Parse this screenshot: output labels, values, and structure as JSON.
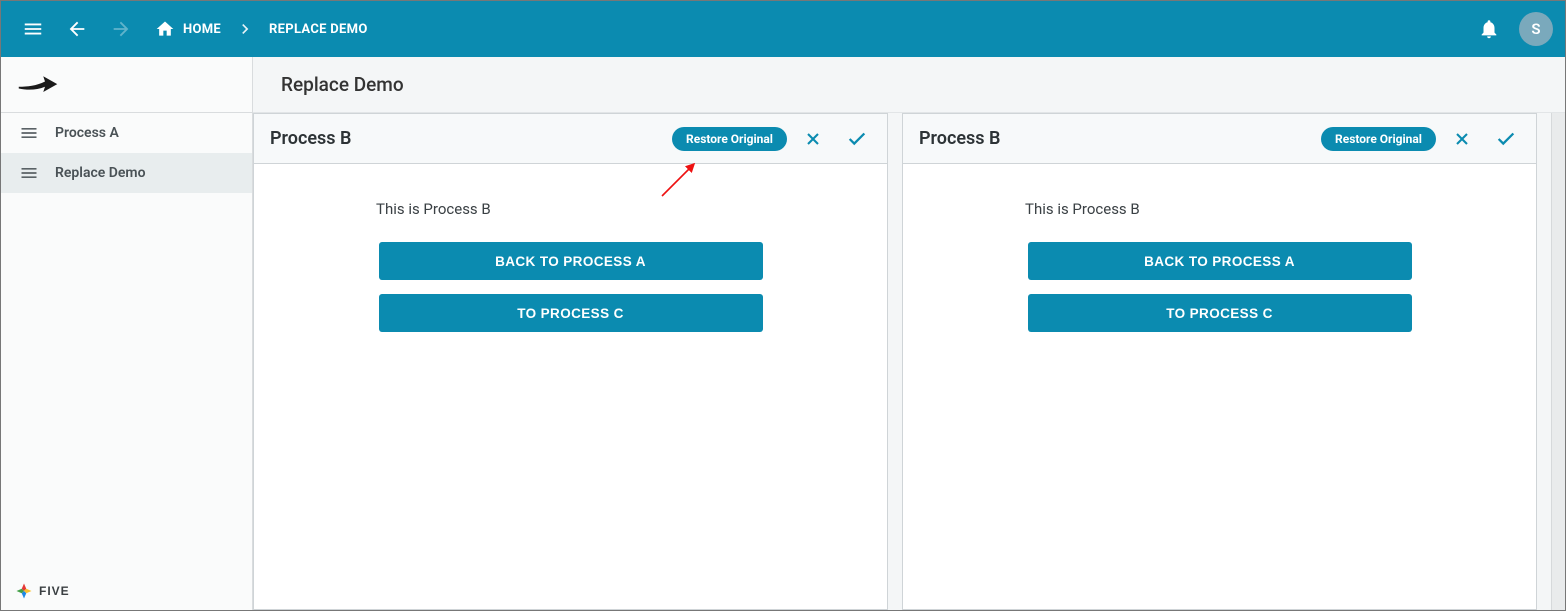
{
  "appbar": {
    "home_label": "HOME",
    "current_label": "REPLACE DEMO",
    "avatar_initial": "S"
  },
  "sidebar": {
    "items": [
      {
        "label": "Process A"
      },
      {
        "label": "Replace Demo"
      }
    ],
    "brand": "FIVE"
  },
  "main": {
    "title": "Replace Demo"
  },
  "panels": [
    {
      "title": "Process B",
      "restore_label": "Restore Original",
      "body_text": "This is Process B",
      "btn_back": "BACK TO PROCESS A",
      "btn_next": "TO PROCESS C"
    },
    {
      "title": "Process B",
      "restore_label": "Restore Original",
      "body_text": "This is Process B",
      "btn_back": "BACK TO PROCESS A",
      "btn_next": "TO PROCESS C"
    }
  ]
}
